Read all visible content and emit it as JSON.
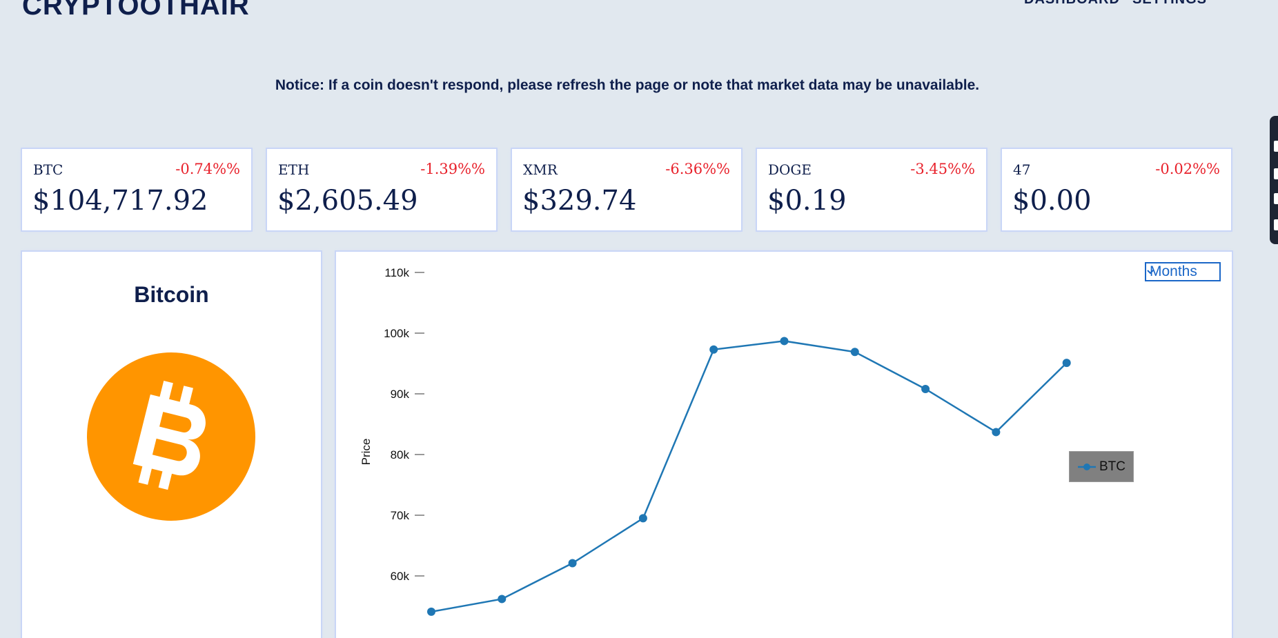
{
  "brand": "CRYPTOOTHAIR",
  "nav": [
    {
      "label": "DASHBOARD"
    },
    {
      "label": "SETTINGS"
    }
  ],
  "notice": "Notice: If a coin doesn't respond, please refresh the page or note that market data may be unavailable.",
  "tickers": [
    {
      "symbol": "BTC",
      "change": "-0.74%%",
      "price": "$104,717.92"
    },
    {
      "symbol": "ETH",
      "change": "-1.39%%",
      "price": "$2,605.49"
    },
    {
      "symbol": "XMR",
      "change": "-6.36%%",
      "price": "$329.74"
    },
    {
      "symbol": "DOGE",
      "change": "-3.45%%",
      "price": "$0.19"
    },
    {
      "symbol": "47",
      "change": "-0.02%%",
      "price": "$0.00"
    }
  ],
  "coin": {
    "name": "Bitcoin",
    "logo_icon": "bitcoin-icon",
    "logo_color": "#f7931a"
  },
  "range_select": {
    "value": "Months"
  },
  "colors": {
    "negative": "#e8212b",
    "accent": "#1a66c7",
    "text": "#0f1f4c",
    "series": "#1f77b4"
  },
  "chart_data": {
    "type": "line",
    "title": "",
    "ylabel": "Price",
    "xlabel": "",
    "ylim": [
      55000,
      110000
    ],
    "yticks": [
      60000,
      70000,
      80000,
      90000,
      100000,
      110000
    ],
    "ytick_labels": [
      "60k",
      "70k",
      "80k",
      "90k",
      "100k",
      "110k"
    ],
    "legend": "right",
    "grid": false,
    "series": [
      {
        "name": "BTC",
        "values": [
          54100,
          56200,
          62100,
          69500,
          97300,
          98700,
          96900,
          90800,
          83700,
          95100
        ]
      }
    ]
  }
}
